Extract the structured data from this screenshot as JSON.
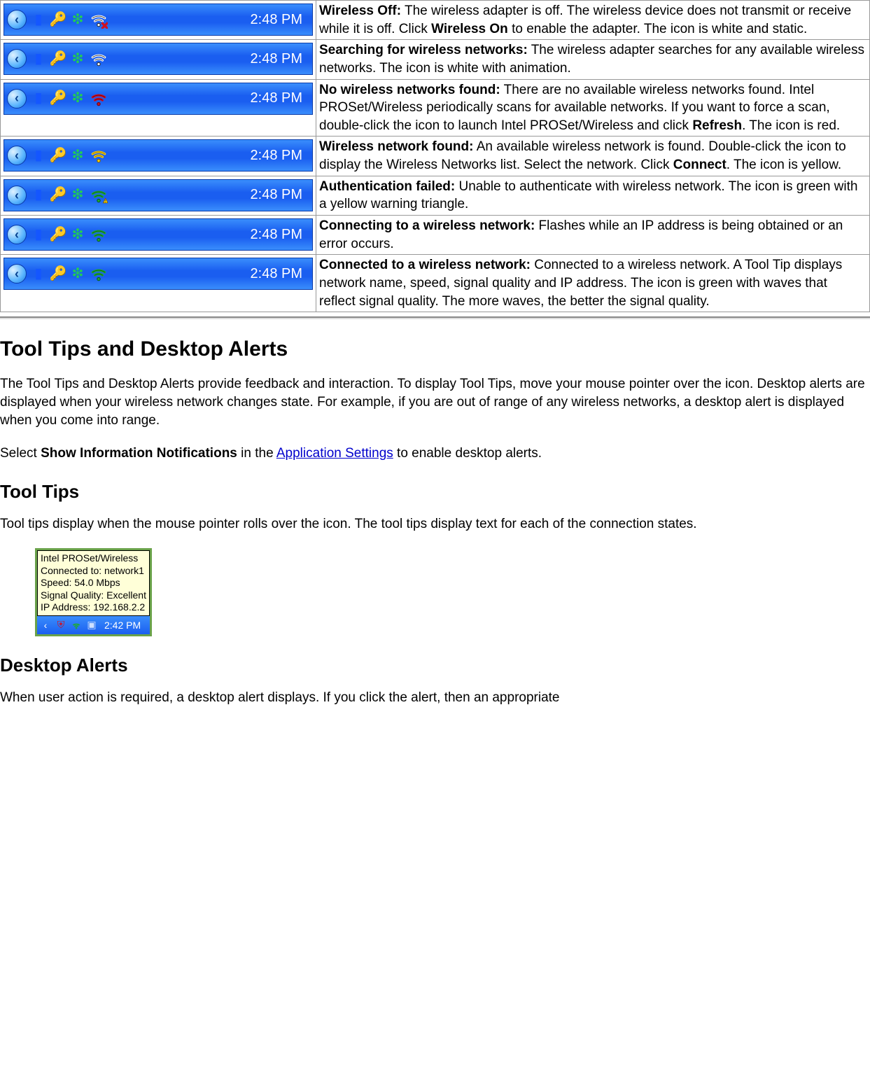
{
  "tray": {
    "chevron_glyph": "‹",
    "clock": "2:48 PM",
    "icons": {
      "battery_color": "#1456ff",
      "keys_color": "#e6b400",
      "globe_color": "#22cc55"
    }
  },
  "states": [
    {
      "title": "Wireless Off:",
      "body_parts": [
        " The wireless adapter is off. The wireless device does not transmit or receive while it is off. Click ",
        "Wireless On",
        " to enable the adapter. The icon is white and static."
      ],
      "wifi": {
        "fill": "#ffffff",
        "stroke": "#2a2a2a",
        "x_overlay": true,
        "x_color": "#d01020"
      }
    },
    {
      "title": "Searching for wireless networks:",
      "body_parts": [
        " The wireless adapter searches for any available wireless networks. The icon is white with animation."
      ],
      "wifi": {
        "fill": "#ffffff",
        "stroke": "#2a2a2a"
      }
    },
    {
      "title": "No wireless networks found:",
      "body_parts": [
        " There are no available wireless networks found. Intel PROSet/Wireless periodically scans for available networks. If you want to force a scan, double-click the icon to launch Intel PROSet/Wireless and click ",
        "Refresh",
        ". The icon is red."
      ],
      "wifi": {
        "fill": "#d01020",
        "stroke": "#700010"
      }
    },
    {
      "title": "Wireless network found:",
      "body_parts": [
        " An available wireless network is found. Double-click the icon to display the Wireless Networks list. Select the network. Click ",
        "Connect",
        ". The icon is yellow."
      ],
      "wifi": {
        "fill": "#ffd400",
        "stroke": "#806000"
      }
    },
    {
      "title": "Authentication failed:",
      "body_parts": [
        " Unable to authenticate with wireless network. The icon is green with a yellow warning triangle."
      ],
      "wifi": {
        "fill": "#1faa33",
        "stroke": "#0a5a18",
        "warn_overlay": true
      }
    },
    {
      "title": "Connecting to a wireless network:",
      "body_parts": [
        " Flashes while an IP address is being obtained or an error occurs."
      ],
      "wifi": {
        "fill": "#1faa33",
        "stroke": "#0a5a18"
      }
    },
    {
      "title": "Connected to a wireless network:",
      "body_parts": [
        " Connected to a wireless network. A Tool Tip displays network name, speed, signal quality and IP address. The icon is green with waves that reflect signal quality. The more waves, the better the signal quality."
      ],
      "wifi": {
        "fill": "#1faa33",
        "stroke": "#0a5a18"
      }
    }
  ],
  "headings": {
    "h2_tooltips_alerts": "Tool Tips and Desktop Alerts",
    "h3_tooltips": "Tool Tips",
    "h3_desktop_alerts": "Desktop Alerts"
  },
  "paragraphs": {
    "tooltips_alerts_intro": "The Tool Tips and Desktop Alerts provide feedback and interaction. To display Tool Tips, move your mouse pointer over the icon. Desktop alerts are displayed when your wireless network changes state. For example, if you are out of range of any wireless networks, a desktop alert is displayed when you come into range.",
    "select_pre": "Select ",
    "select_bold": "Show Information Notifications",
    "select_mid": " in the ",
    "select_link": "Application Settings",
    "select_post": " to enable desktop alerts.",
    "tooltips_body": "Tool tips display when the mouse pointer rolls over the icon. The tool tips display text for each of the connection states.",
    "desktop_alerts_body": "When user action is required, a desktop alert displays. If you click the alert, then an appropriate"
  },
  "tooltip_figure": {
    "lines": [
      "Intel PROSet/Wireless",
      "Connected to: network1",
      "Speed: 54.0 Mbps",
      "Signal Quality: Excellent",
      "IP Address: 192.168.2.2"
    ],
    "clock": "2:42 PM"
  }
}
